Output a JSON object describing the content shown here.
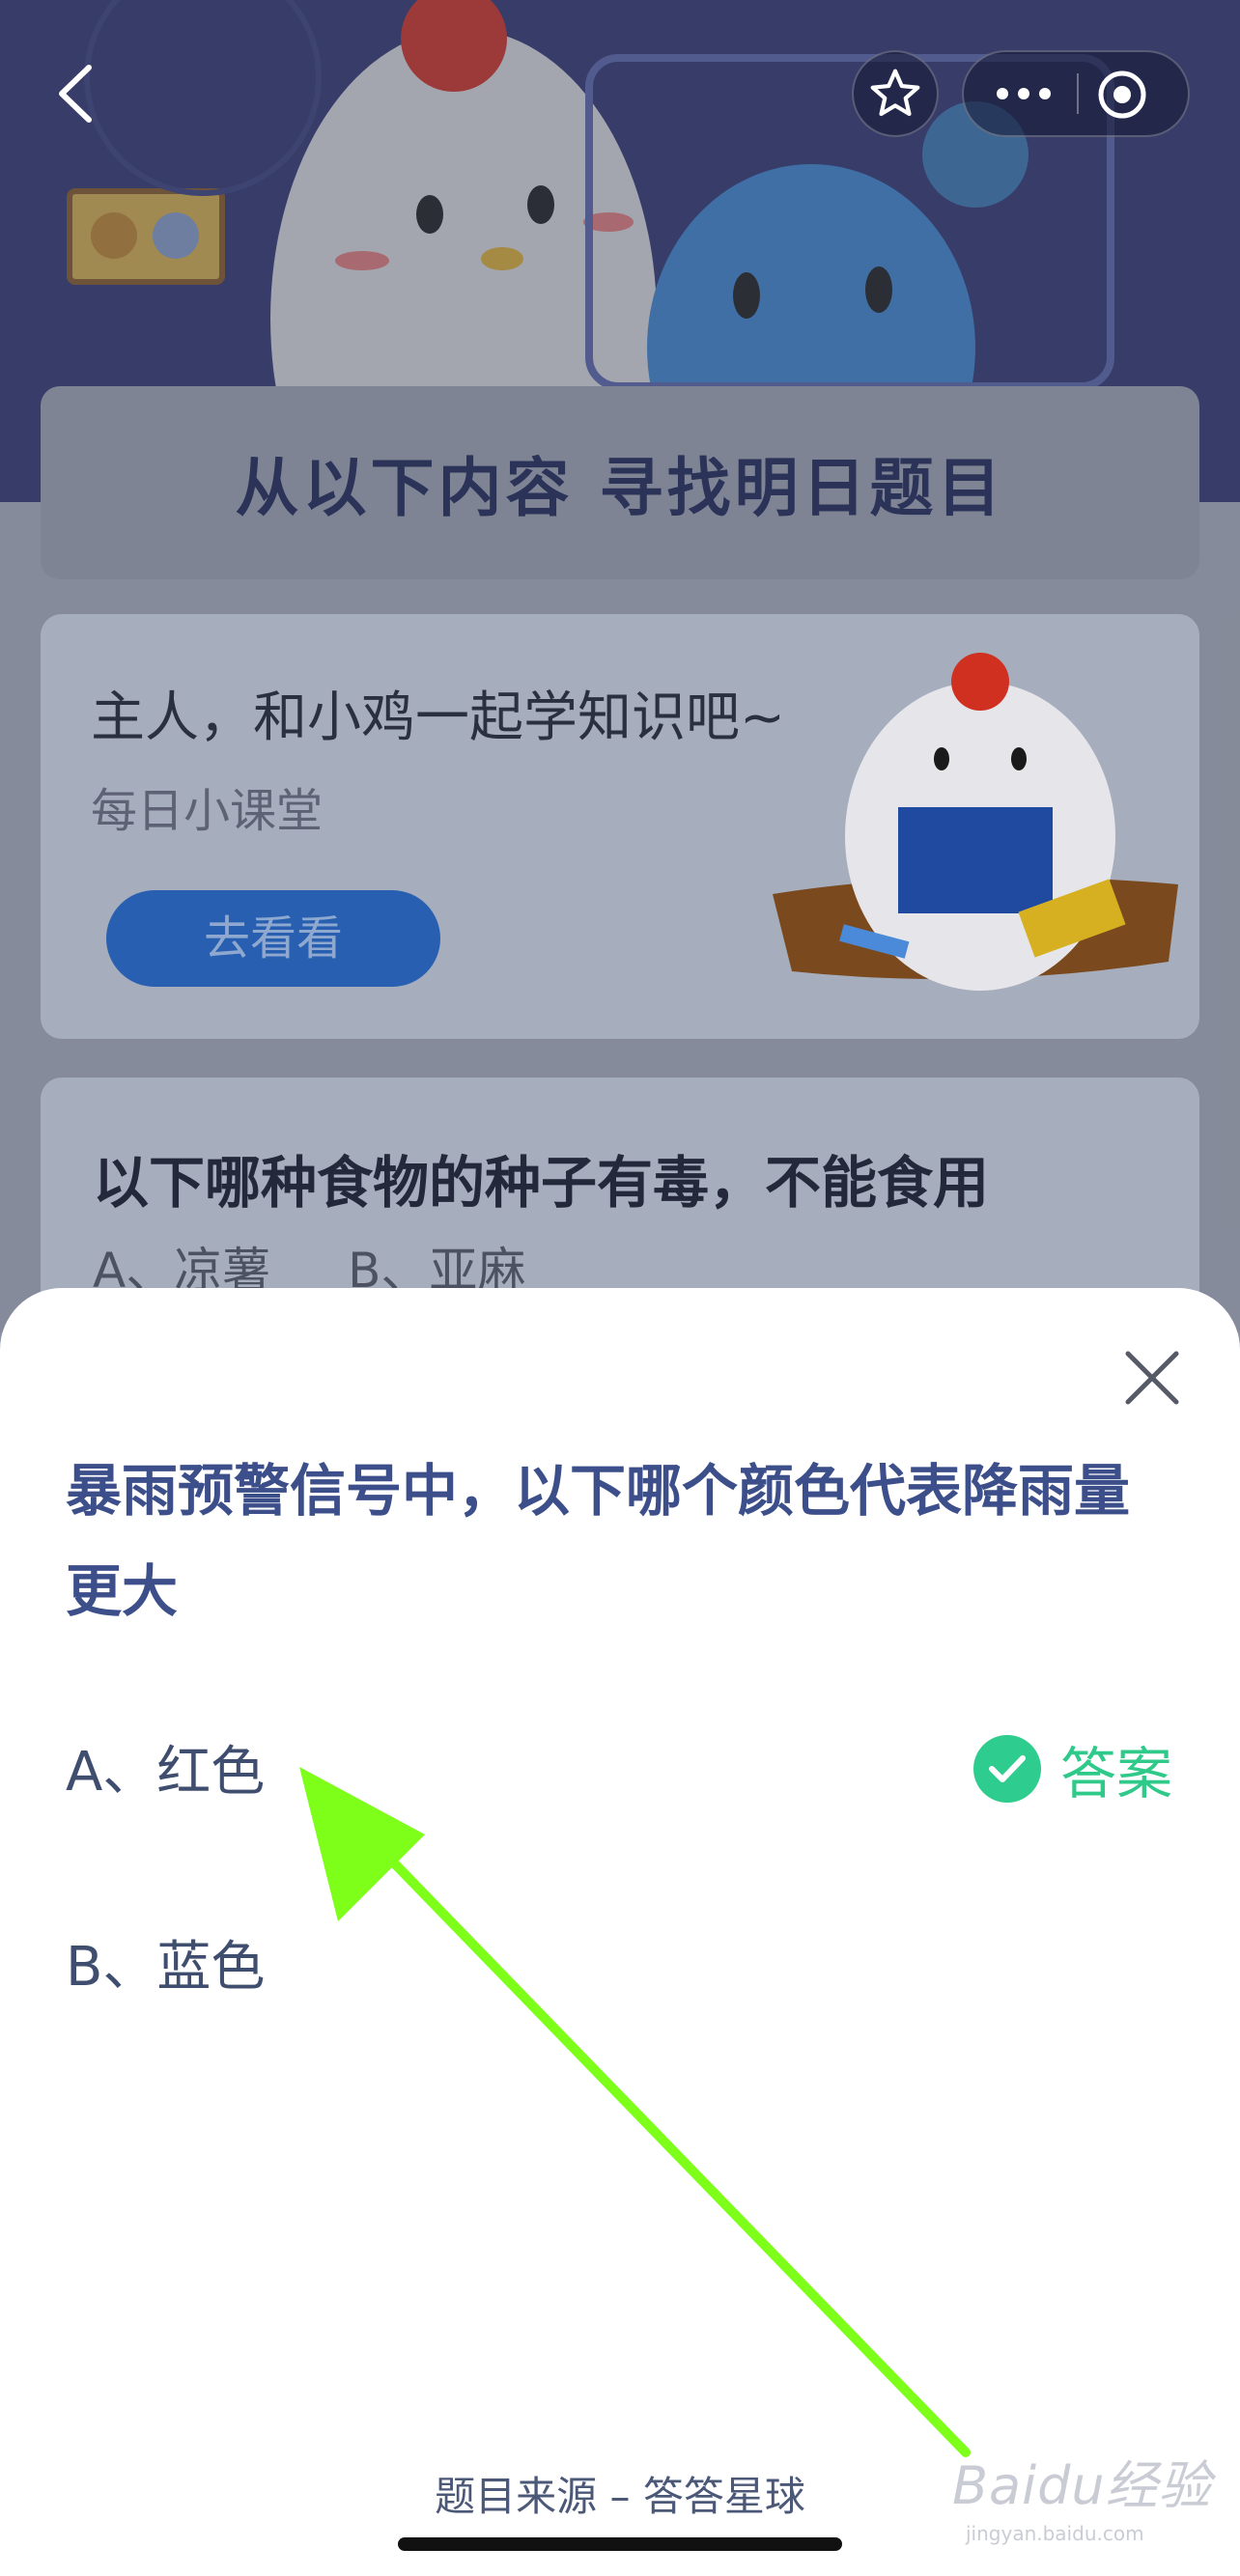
{
  "banner": {
    "title": "从以下内容  寻找明日题目"
  },
  "lesson_card": {
    "title": "主人，和小鸡一起学知识吧~",
    "subtitle": "每日小课堂",
    "button_label": "去看看"
  },
  "question_card": {
    "title": "以下哪种食物的种子有毒，不能食用",
    "options": [
      "A、凉薯",
      "B、亚麻"
    ]
  },
  "sheet": {
    "question": "暴雨预警信号中，以下哪个颜色代表降雨量更大",
    "options": [
      "A、红色",
      "B、蓝色"
    ],
    "answer_label": "答案",
    "source": "题目来源 – 答答星球"
  },
  "watermark": {
    "brand": "Baidu经验",
    "url": "jingyan.baidu.com"
  },
  "colors": {
    "accent": "#2ecc8e",
    "question_text": "#3d4f8a",
    "arrow": "#7dff1a"
  },
  "icons": [
    "back-icon",
    "star-icon",
    "more-icon",
    "target-icon",
    "close-icon",
    "check-icon"
  ]
}
